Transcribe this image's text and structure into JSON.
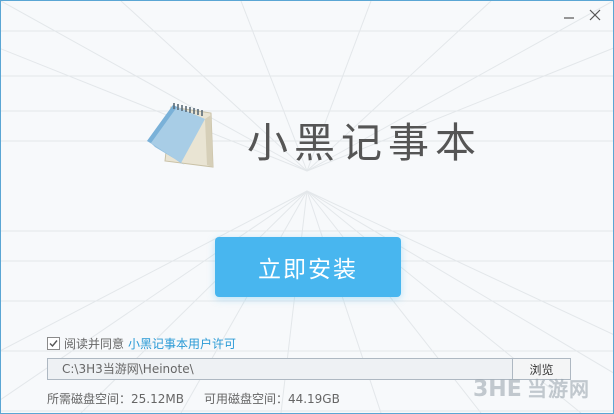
{
  "window": {
    "minimize_label": "minimize",
    "close_label": "close"
  },
  "app": {
    "title": "小黑记事本",
    "icon": "notepad-icon"
  },
  "install": {
    "label": "立即安装"
  },
  "agreement": {
    "checked": true,
    "prefix": "阅读并同意",
    "link": "小黑记事本用户许可"
  },
  "path": {
    "value": "C:\\3H3当游网\\Heinote\\",
    "browse_label": "浏览"
  },
  "space": {
    "required": "所需磁盘空间：25.12MB",
    "available": "可用磁盘空间：44.19GB"
  },
  "watermark": {
    "brand": "3HE",
    "text": "当游网"
  },
  "colors": {
    "accent": "#48b6ef",
    "link": "#2a9ad6",
    "border": "#5aa6d4"
  }
}
